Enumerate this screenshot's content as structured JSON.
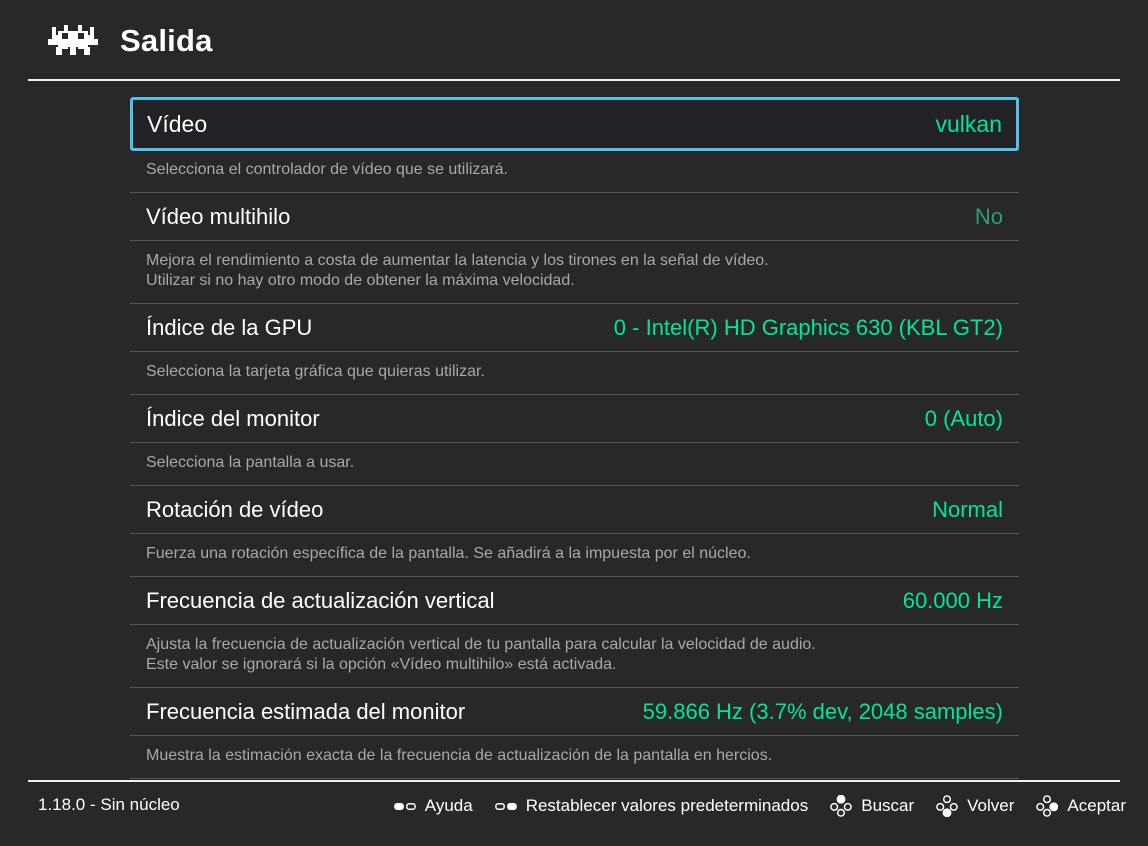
{
  "header": {
    "title": "Salida",
    "logo_icon": "retroarch-logo-icon"
  },
  "settings": [
    {
      "name": "video-driver",
      "label": "Vídeo",
      "value": "vulkan",
      "value_style": "bright",
      "selected": true,
      "description": "Selecciona el controlador de vídeo que se utilizará."
    },
    {
      "name": "threaded-video",
      "label": "Vídeo multihilo",
      "value": "No",
      "value_style": "dim",
      "selected": false,
      "description": "Mejora el rendimiento a costa de aumentar la latencia y los tirones en la señal de vídeo.\nUtilizar si no hay otro modo de obtener la máxima velocidad."
    },
    {
      "name": "gpu-index",
      "label": "Índice de la GPU",
      "value": "0 - Intel(R) HD Graphics 630 (KBL GT2)",
      "value_style": "bright",
      "selected": false,
      "description": "Selecciona la tarjeta gráfica que quieras utilizar."
    },
    {
      "name": "monitor-index",
      "label": "Índice del monitor",
      "value": "0 (Auto)",
      "value_style": "bright",
      "selected": false,
      "description": "Selecciona la pantalla a usar."
    },
    {
      "name": "video-rotation",
      "label": "Rotación de vídeo",
      "value": "Normal",
      "value_style": "bright",
      "selected": false,
      "description": "Fuerza una rotación específica de la pantalla. Se añadirá a la impuesta por el núcleo."
    },
    {
      "name": "vertical-refresh-rate",
      "label": "Frecuencia de actualización vertical",
      "value": "60.000 Hz",
      "value_style": "bright",
      "selected": false,
      "description": "Ajusta la frecuencia de actualización vertical de tu pantalla para calcular la velocidad de audio.\nEste valor se ignorará si la opción «Vídeo multihilo» está activada."
    },
    {
      "name": "estimated-monitor-framerate",
      "label": "Frecuencia estimada del monitor",
      "value": "59.866 Hz (3.7% dev, 2048 samples)",
      "value_style": "bright",
      "selected": false,
      "description": "Muestra la estimación exacta de la frecuencia de actualización de la pantalla en hercios."
    }
  ],
  "footer": {
    "version": "1.18.0 - Sin núcleo",
    "actions": [
      {
        "name": "help",
        "label": "Ayuda",
        "icon": "gamepad-shoulder-left-icon"
      },
      {
        "name": "reset-defaults",
        "label": "Restablecer valores predeterminados",
        "icon": "gamepad-shoulder-right-icon"
      },
      {
        "name": "search",
        "label": "Buscar",
        "icon": "gamepad-button-up-icon"
      },
      {
        "name": "back",
        "label": "Volver",
        "icon": "gamepad-button-down-icon"
      },
      {
        "name": "accept",
        "label": "Aceptar",
        "icon": "gamepad-button-right-icon"
      }
    ]
  },
  "colors": {
    "background": "#282828",
    "value_bright": "#00e5a0",
    "value_dim": "#2f9e72",
    "selection_border": "#4fc3e8",
    "separator": "#565656",
    "description_text": "#a8a8a8",
    "label_text": "#ffffff"
  }
}
